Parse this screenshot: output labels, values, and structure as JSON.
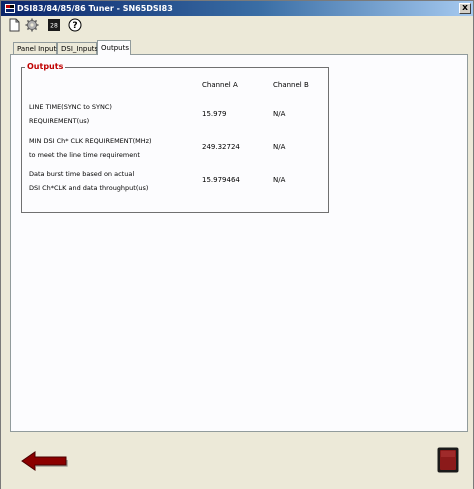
{
  "window": {
    "title": "DSI83/84/85/86 Tuner - SN65DSI83",
    "close_label": "x"
  },
  "toolbar": {
    "buttons": [
      {
        "name": "new-document-icon"
      },
      {
        "name": "gear-icon"
      },
      {
        "name": "chip-icon",
        "text": "28"
      },
      {
        "name": "help-icon",
        "text": "?"
      }
    ]
  },
  "tabs": [
    {
      "label": "Panel Inputs",
      "active": false
    },
    {
      "label": "DSI_Inputs",
      "active": false
    },
    {
      "label": "Outputs",
      "active": true
    }
  ],
  "outputs": {
    "group_title": "Outputs",
    "columns": [
      "Channel A",
      "Channel B"
    ],
    "rows": [
      {
        "label_line1": "LINE TIME(SYNC to SYNC)",
        "label_line2": "REQUIREMENT(us)",
        "channel_a": "15.979",
        "channel_b": "N/A"
      },
      {
        "label_line1": "MIN DSI Ch* CLK REQUIREMENT(MHz)",
        "label_line2": "to meet the line time requirement",
        "channel_a": "249.32724",
        "channel_b": "N/A"
      },
      {
        "label_line1": "Data burst time based on actual",
        "label_line2": "DSI Ch*CLK and data throughput(us)",
        "channel_a": "15.979464",
        "channel_b": "N/A"
      }
    ]
  },
  "colors": {
    "accent": "#c00000",
    "arrow": "#8b0000",
    "exit_button": "#8b1a1a"
  },
  "icons": {
    "back": "back-arrow-icon",
    "exit": "exit-icon"
  }
}
